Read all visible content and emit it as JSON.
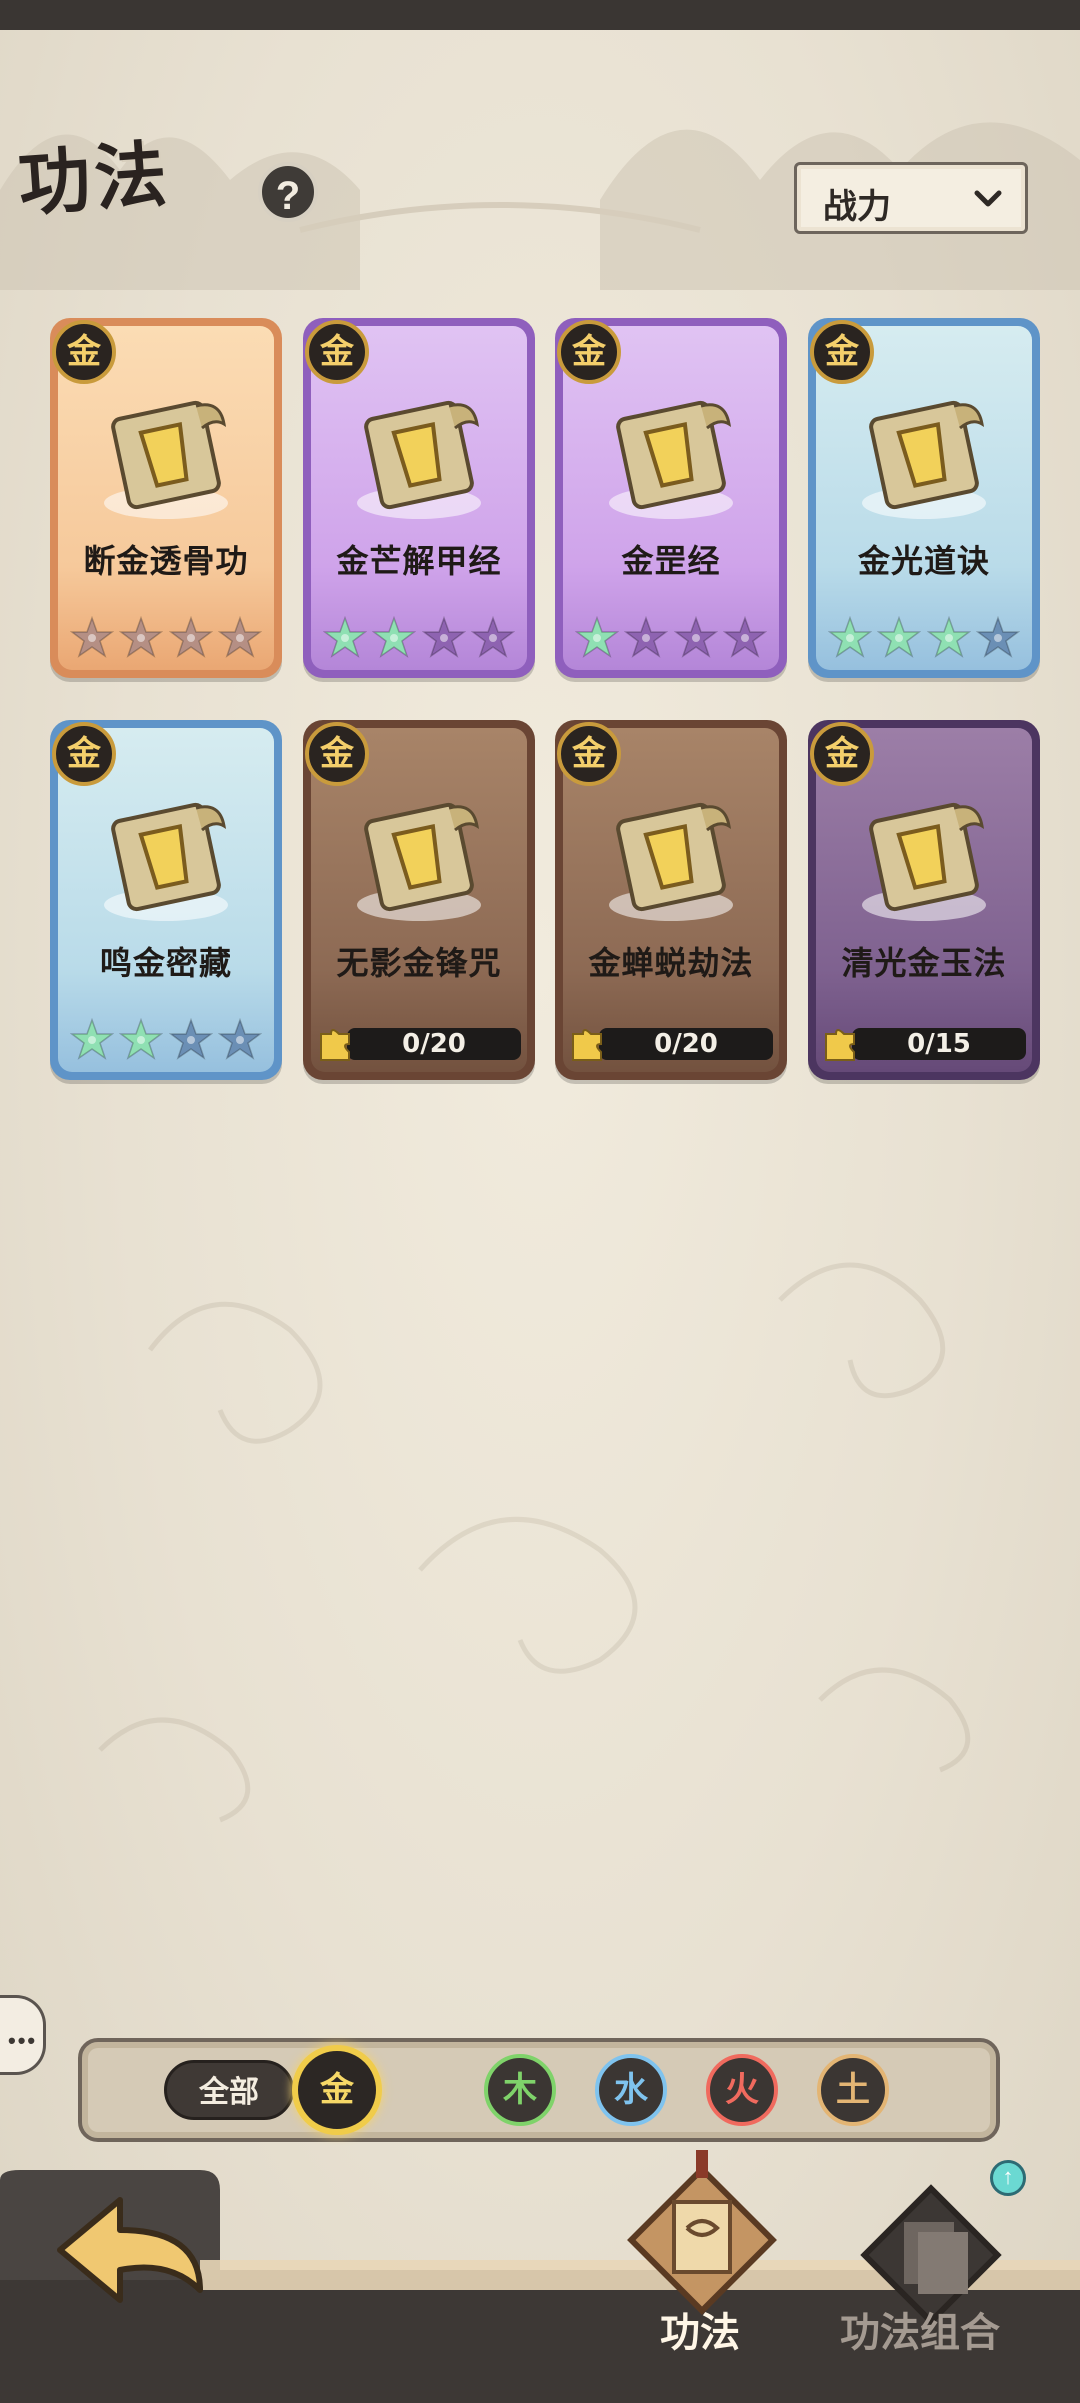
{
  "header": {
    "title": "功法",
    "help_symbol": "?",
    "sort_label": "战力"
  },
  "cards": [
    {
      "name": "断金透骨功",
      "element": "金",
      "frame": "orange",
      "stars_lit": 0,
      "stars_total": 4,
      "star_color": "#b58f84"
    },
    {
      "name": "金芒解甲经",
      "element": "金",
      "frame": "purple",
      "stars_lit": 2,
      "stars_total": 4,
      "star_color": "#8e63b1"
    },
    {
      "name": "金罡经",
      "element": "金",
      "frame": "purple",
      "stars_lit": 1,
      "stars_total": 4,
      "star_color": "#8e63b1"
    },
    {
      "name": "金光道诀",
      "element": "金",
      "frame": "blue",
      "stars_lit": 3,
      "stars_total": 4,
      "star_color": "#6b8fb5"
    },
    {
      "name": "鸣金密藏",
      "element": "金",
      "frame": "blue",
      "stars_lit": 2,
      "stars_total": 4,
      "star_color": "#6b8fb5"
    },
    {
      "name": "无影金锋咒",
      "element": "金",
      "frame": "brown",
      "fragments": "0/20"
    },
    {
      "name": "金蝉蜕劫法",
      "element": "金",
      "frame": "brown",
      "fragments": "0/20"
    },
    {
      "name": "清光金玉法",
      "element": "金",
      "frame": "dpurple",
      "fragments": "0/15"
    }
  ],
  "filter": {
    "all_label": "全部",
    "elements": [
      {
        "label": "金",
        "color": "#f4d15c",
        "selected": true
      },
      {
        "label": "木",
        "color": "#7fd36a",
        "selected": false
      },
      {
        "label": "水",
        "color": "#7fc3ee",
        "selected": false
      },
      {
        "label": "火",
        "color": "#f06a5e",
        "selected": false
      },
      {
        "label": "土",
        "color": "#e3b574",
        "selected": false
      }
    ]
  },
  "nav": {
    "tab1": "功法",
    "tab2": "功法组合",
    "notif_symbol": "↑"
  },
  "colors": {
    "lit_star": "#8fe0b3",
    "gold": "#f4cf6b",
    "dark": "#2a2420"
  }
}
